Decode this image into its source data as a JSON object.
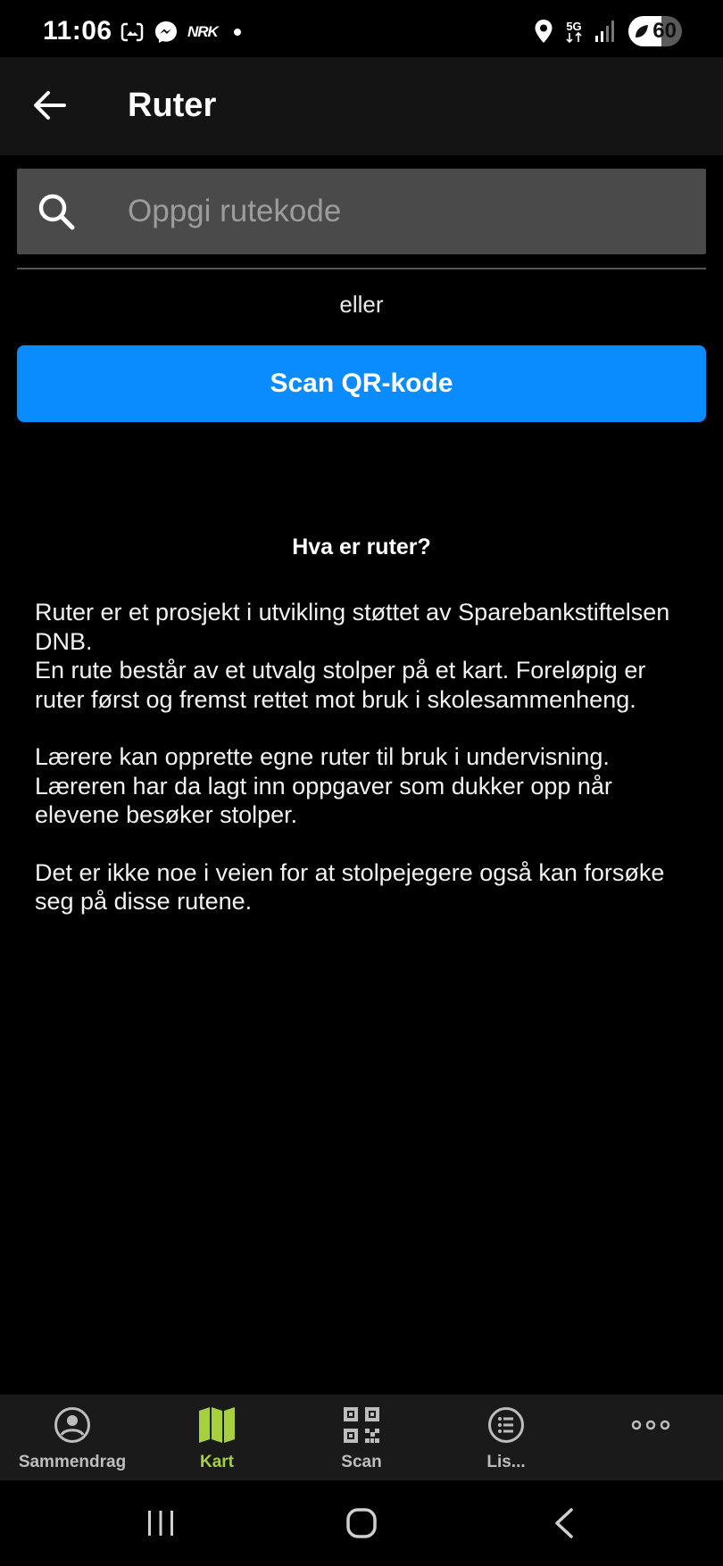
{
  "status_bar": {
    "time": "11:06",
    "nrk_label": "NRK",
    "network_label": "5G",
    "battery_level": "60"
  },
  "app_bar": {
    "title": "Ruter"
  },
  "search": {
    "placeholder": "Oppgi rutekode",
    "value": ""
  },
  "or_label": "eller",
  "scan_button_label": "Scan QR-kode",
  "info": {
    "heading": "Hva er ruter?",
    "paragraph_1_line_1": "Ruter er et prosjekt i utvikling støttet av Sparebankstiftelsen DNB.",
    "paragraph_1_line_2": "En rute består av et utvalg stolper på et kart. Foreløpig er ruter først og fremst rettet mot bruk i skolesammenheng.",
    "paragraph_2": "Lærere kan opprette egne ruter til bruk i undervisning. Læreren har da lagt inn oppgaver som dukker opp når elevene besøker stolper.",
    "paragraph_3": "Det er ikke noe i veien for at stolpejegere også kan forsøke seg på disse rutene."
  },
  "bottom_nav": {
    "items": [
      {
        "label": "Sammendrag",
        "icon": "account-circle-icon"
      },
      {
        "label": "Kart",
        "icon": "map-icon",
        "active": true
      },
      {
        "label": "Scan",
        "icon": "qr-code-icon"
      },
      {
        "label": "Lis...",
        "icon": "list-icon"
      },
      {
        "label": "",
        "icon": "more-icon"
      }
    ]
  },
  "colors": {
    "accent": "#0a8cff",
    "active_nav": "#a6d13c",
    "background": "#000000",
    "app_bar": "#141414",
    "search_bg": "#4a4a4a"
  }
}
